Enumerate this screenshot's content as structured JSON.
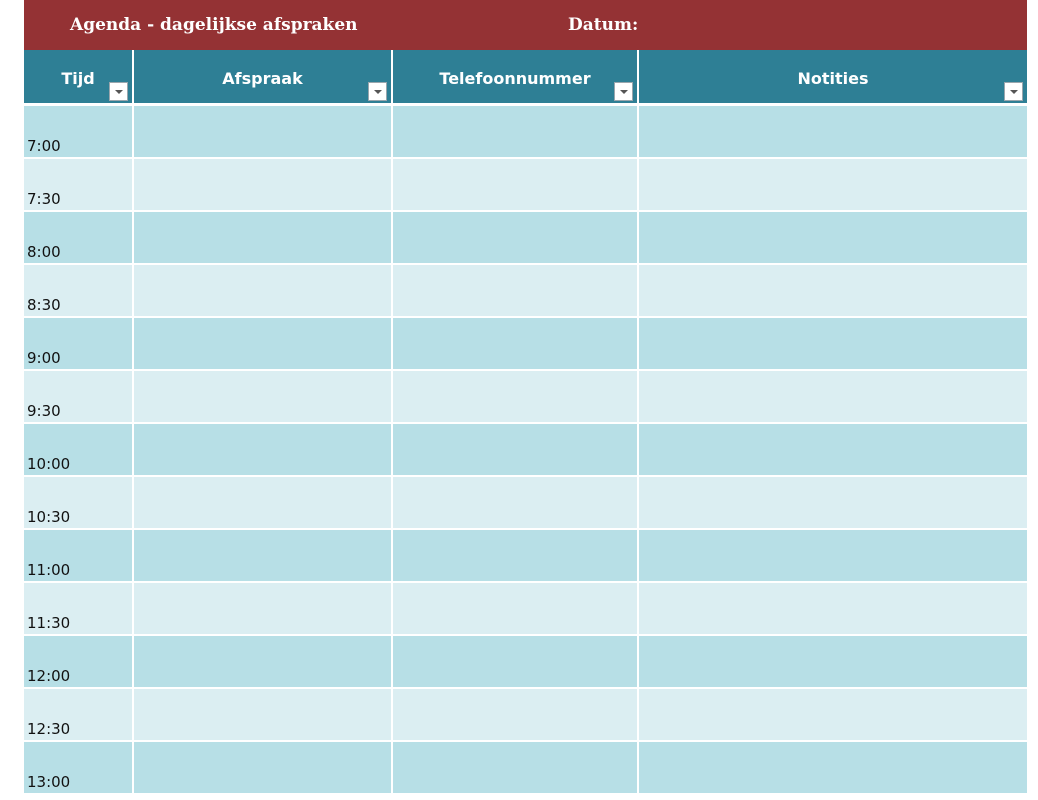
{
  "title": "Agenda - dagelijkse afspraken",
  "date_label": "Datum:",
  "columns": [
    {
      "label": "Tijd"
    },
    {
      "label": "Afspraak"
    },
    {
      "label": "Telefoonnummer"
    },
    {
      "label": "Notities"
    }
  ],
  "rows": [
    {
      "time": "7:00"
    },
    {
      "time": "7:30"
    },
    {
      "time": "8:00"
    },
    {
      "time": "8:30"
    },
    {
      "time": "9:00"
    },
    {
      "time": "9:30"
    },
    {
      "time": "10:00"
    },
    {
      "time": "10:30"
    },
    {
      "time": "11:00"
    },
    {
      "time": "11:30"
    },
    {
      "time": "12:00"
    },
    {
      "time": "12:30"
    },
    {
      "time": "13:00"
    }
  ],
  "colors": {
    "title_bg": "#943234",
    "header_bg": "#2e7f95",
    "row_dark": "#b7dfe6",
    "row_light": "#dbeef2"
  }
}
